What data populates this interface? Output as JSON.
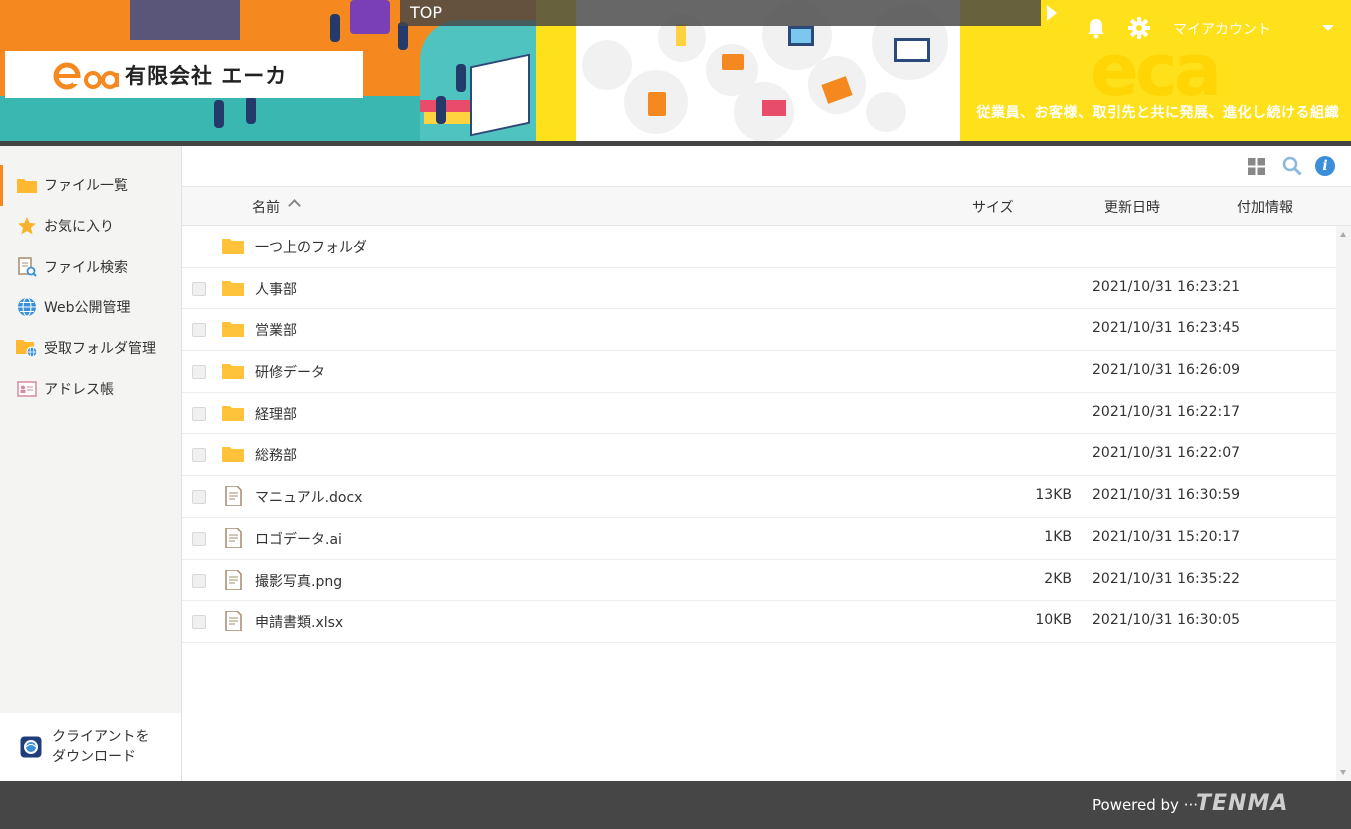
{
  "header": {
    "company_name": "有限会社 エーカ",
    "top_label": "TOP",
    "account_label": "マイアカウント",
    "slogan": "従業員、お客様、取引先と共に発展、進化し続ける組織",
    "logo_text": "eca"
  },
  "sidebar": {
    "items": [
      {
        "label": "ファイル一覧",
        "icon": "folder-icon"
      },
      {
        "label": "お気に入り",
        "icon": "star-icon"
      },
      {
        "label": "ファイル検索",
        "icon": "file-search-icon"
      },
      {
        "label": "Web公開管理",
        "icon": "globe-icon"
      },
      {
        "label": "受取フォルダ管理",
        "icon": "folder-globe-icon"
      },
      {
        "label": "アドレス帳",
        "icon": "address-book-icon"
      }
    ],
    "download": {
      "line1": "クライアントを",
      "line2": "ダウンロード"
    }
  },
  "table": {
    "headers": {
      "name": "名前",
      "size": "サイズ",
      "updated": "更新日時",
      "extra": "付加情報"
    },
    "parent_folder": "一つ上のフォルダ",
    "rows": [
      {
        "type": "folder",
        "name": "人事部",
        "size": "",
        "updated": "2021/10/31 16:23:21"
      },
      {
        "type": "folder",
        "name": "営業部",
        "size": "",
        "updated": "2021/10/31 16:23:45"
      },
      {
        "type": "folder",
        "name": "研修データ",
        "size": "",
        "updated": "2021/10/31 16:26:09"
      },
      {
        "type": "folder",
        "name": "経理部",
        "size": "",
        "updated": "2021/10/31 16:22:17"
      },
      {
        "type": "folder",
        "name": "総務部",
        "size": "",
        "updated": "2021/10/31 16:22:07"
      },
      {
        "type": "file",
        "name": "マニュアル.docx",
        "size": "13KB",
        "updated": "2021/10/31 16:30:59"
      },
      {
        "type": "file",
        "name": "ロゴデータ.ai",
        "size": "1KB",
        "updated": "2021/10/31 15:20:17"
      },
      {
        "type": "file",
        "name": "撮影写真.png",
        "size": "2KB",
        "updated": "2021/10/31 16:35:22"
      },
      {
        "type": "file",
        "name": "申請書類.xlsx",
        "size": "10KB",
        "updated": "2021/10/31 16:30:05"
      }
    ]
  },
  "footer": {
    "powered": "Powered by ···",
    "brand": "TENMA"
  },
  "colors": {
    "accent": "#f5891f",
    "header_yellow": "#ffe11b",
    "folder": "#ffc23a",
    "footer": "#464646"
  }
}
